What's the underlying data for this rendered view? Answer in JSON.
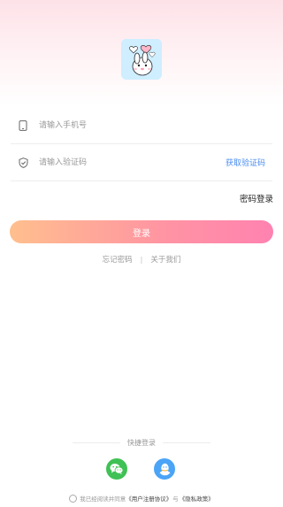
{
  "login_form": {
    "phone_placeholder": "请输入手机号",
    "code_placeholder": "请输入验证码",
    "get_code_label": "获取验证码",
    "password_login_label": "密码登录",
    "submit_label": "登录"
  },
  "links": {
    "forgot_password": "忘记密码",
    "separator": "|",
    "about_us": "关于我们"
  },
  "quick_login": {
    "label": "快捷登录",
    "providers": [
      "wechat-icon",
      "qq-icon"
    ]
  },
  "agreement": {
    "prefix": "我已经阅读并同意",
    "user_agreement": "《用户注册协议》",
    "conjunction": "与",
    "privacy_policy": "《隐私政策》"
  },
  "colors": {
    "accent_start": "#ffbf8e",
    "accent_end": "#ff82b0",
    "link_blue": "#4a8cf0",
    "wechat_green": "#3fc155",
    "qq_blue": "#4ba4f6"
  }
}
